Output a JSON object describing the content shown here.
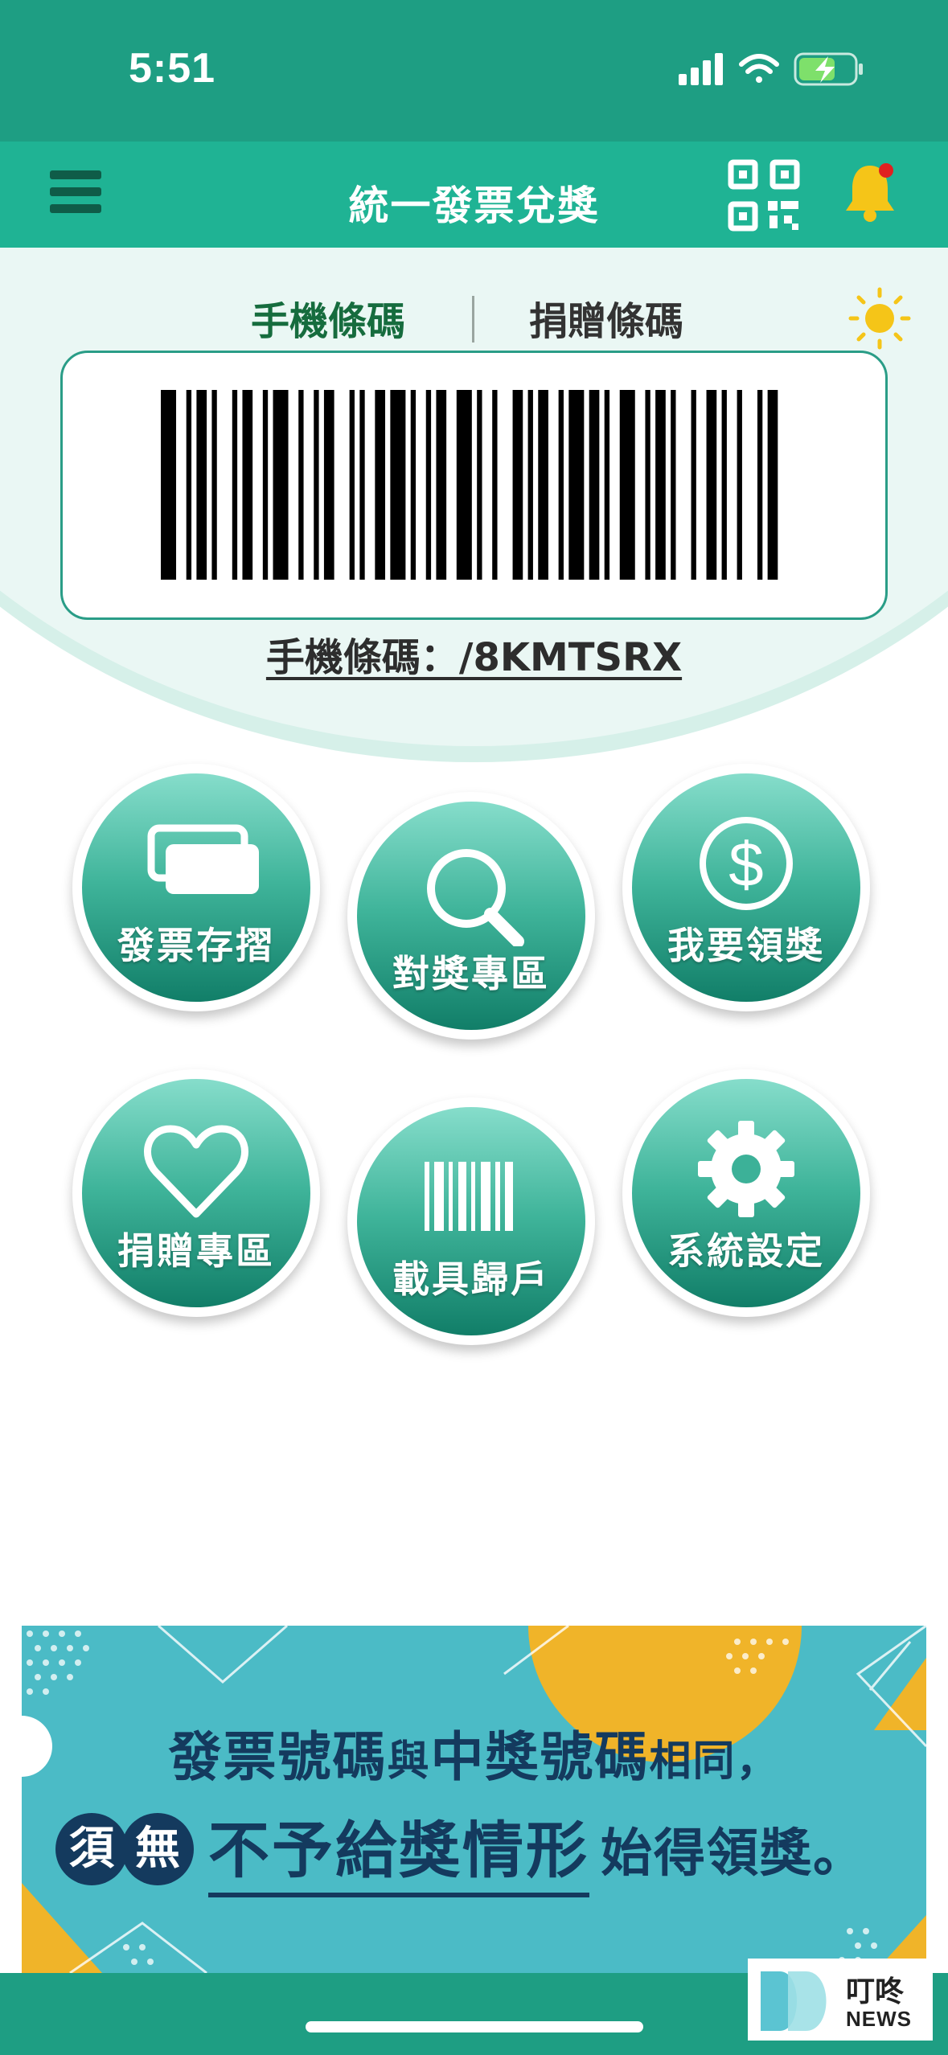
{
  "status_bar": {
    "time": "5:51"
  },
  "nav": {
    "title": "統一發票兌獎"
  },
  "tabs": [
    {
      "label": "手機條碼",
      "active": true
    },
    {
      "label": "捐贈條碼",
      "active": false
    }
  ],
  "barcode": {
    "caption": "手機條碼：/8KMTSRX"
  },
  "menu_buttons": [
    {
      "label": "發票存摺",
      "icon": "receipts-icon"
    },
    {
      "label": "對獎專區",
      "icon": "search-icon"
    },
    {
      "label": "我要領獎",
      "icon": "dollar-icon"
    },
    {
      "label": "捐贈專區",
      "icon": "heart-icon"
    },
    {
      "label": "載具歸戶",
      "icon": "barcode-icon"
    },
    {
      "label": "系統設定",
      "icon": "gear-icon"
    }
  ],
  "banner": {
    "line1_a": "發票號碼",
    "line1_b": "與",
    "line1_c": "中獎號碼",
    "line1_d": "相同，",
    "seal1": "須",
    "seal2": "無",
    "emphasis": "不予給獎情形",
    "tail": "始得領獎。"
  },
  "watermark": {
    "cn": "叮咚",
    "en": "NEWS"
  },
  "colors": {
    "primary": "#1e9e83",
    "nav": "#1fb394",
    "accent_dark": "#166c3e",
    "banner_bg": "#4bbbc6",
    "banner_text": "#143a5e",
    "bell": "#f5c518"
  }
}
